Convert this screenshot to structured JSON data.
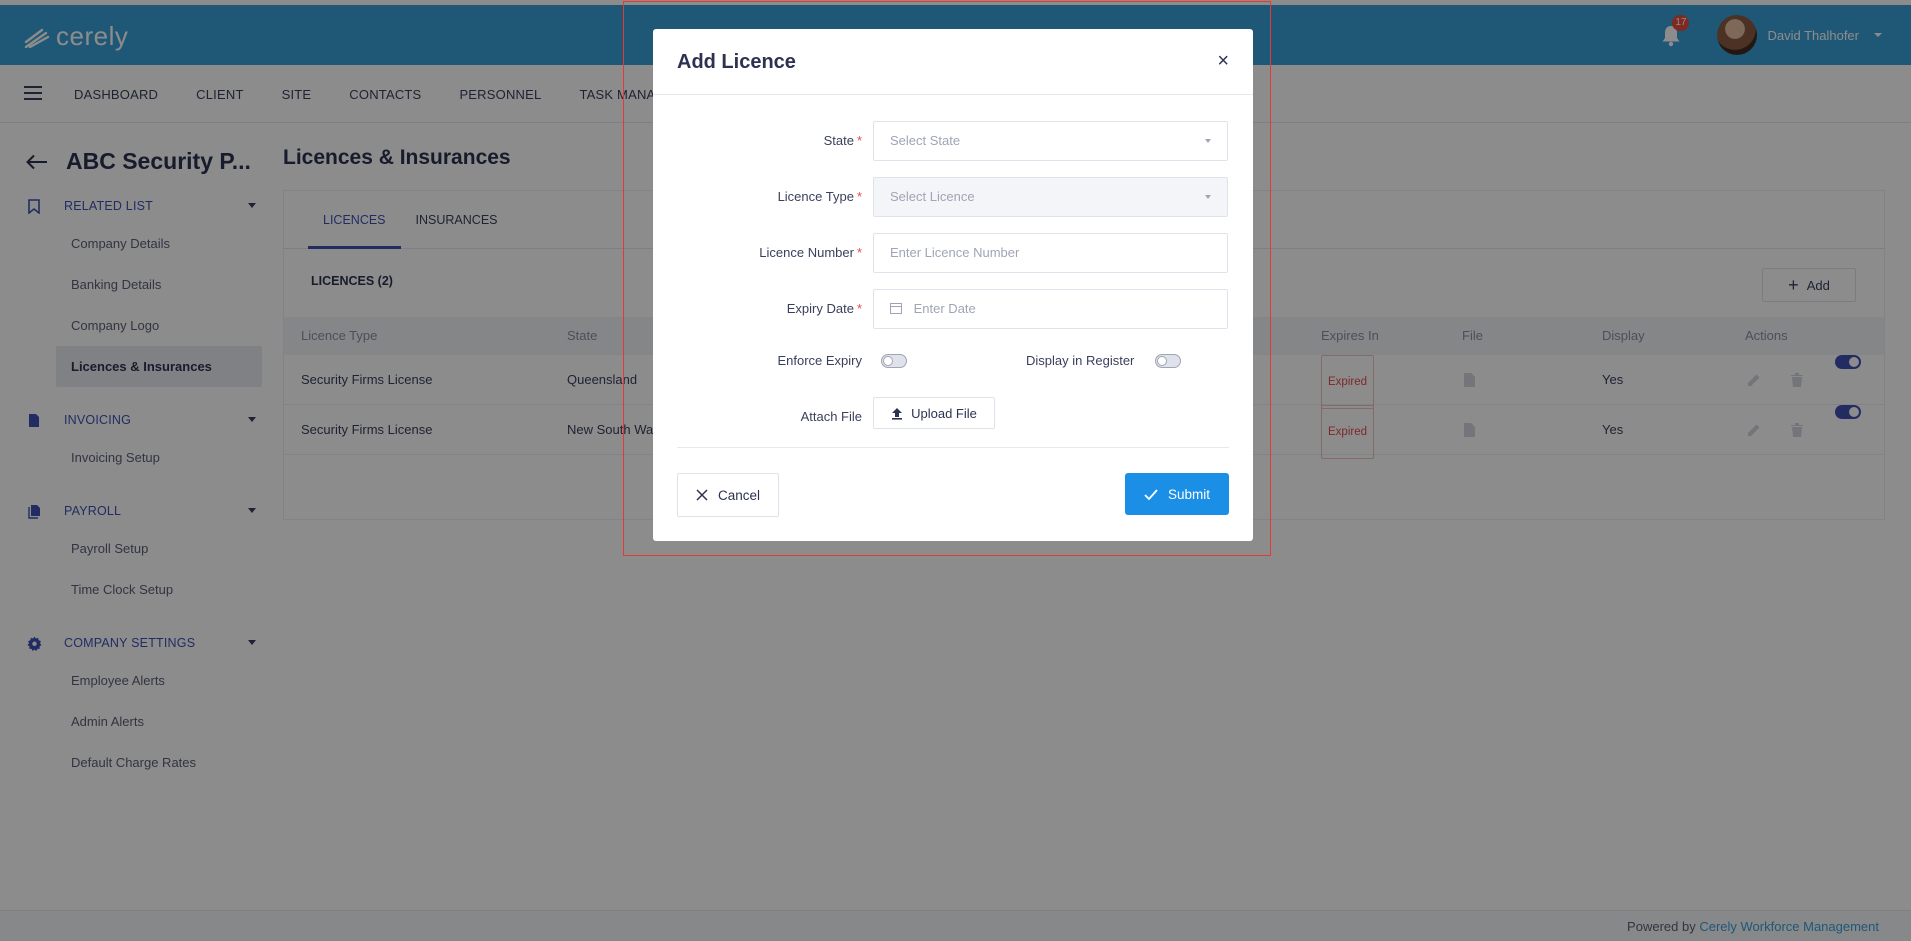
{
  "app": {
    "logo_text": "cerely",
    "notification_count": "17",
    "user_name": "David Thalhofer"
  },
  "nav": {
    "items": [
      "DASHBOARD",
      "CLIENT",
      "SITE",
      "CONTACTS",
      "PERSONNEL",
      "TASK MANAGER"
    ]
  },
  "page": {
    "title": "ABC Security P...",
    "main_title": "Licences & Insurances"
  },
  "sidebar": {
    "sections": [
      {
        "label": "RELATED LIST",
        "icon": "bookmark-icon",
        "items": [
          "Company Details",
          "Banking Details",
          "Company Logo",
          "Licences & Insurances"
        ],
        "active": "Licences & Insurances"
      },
      {
        "label": "INVOICING",
        "icon": "document-icon",
        "items": [
          "Invoicing Setup"
        ]
      },
      {
        "label": "PAYROLL",
        "icon": "files-icon",
        "items": [
          "Payroll Setup",
          "Time Clock Setup"
        ]
      },
      {
        "label": "COMPANY SETTINGS",
        "icon": "gear-icon",
        "items": [
          "Employee Alerts",
          "Admin Alerts",
          "Default Charge Rates"
        ]
      }
    ]
  },
  "tabs": [
    "LICENCES",
    "INSURANCES"
  ],
  "licences": {
    "count_label": "LICENCES (2)",
    "add_label": "Add",
    "columns": [
      "Licence Type",
      "State",
      "Expires In",
      "File",
      "Display",
      "Actions"
    ],
    "rows": [
      {
        "type": "Security Firms License",
        "state": "Queensland",
        "expires": "Expired",
        "display": "Yes"
      },
      {
        "type": "Security Firms License",
        "state": "New South Wa",
        "expires": "Expired",
        "display": "Yes"
      }
    ]
  },
  "footer": {
    "prefix": "Powered by",
    "link": "Cerely Workforce Management"
  },
  "modal": {
    "title": "Add Licence",
    "close": "×",
    "state_label": "State",
    "state_placeholder": "Select State",
    "type_label": "Licence Type",
    "type_placeholder": "Select Licence",
    "number_label": "Licence Number",
    "number_placeholder": "Enter Licence Number",
    "expiry_label": "Expiry Date",
    "expiry_placeholder": "Enter Date",
    "enforce_label": "Enforce Expiry",
    "register_label": "Display in Register",
    "attach_label": "Attach File",
    "upload_label": "Upload File",
    "cancel_label": "Cancel",
    "submit_label": "Submit"
  },
  "colors": {
    "brand": "#3aa1d8",
    "accent": "#3f51b5",
    "submit": "#1b8fe6",
    "danger": "#e54b4b"
  }
}
